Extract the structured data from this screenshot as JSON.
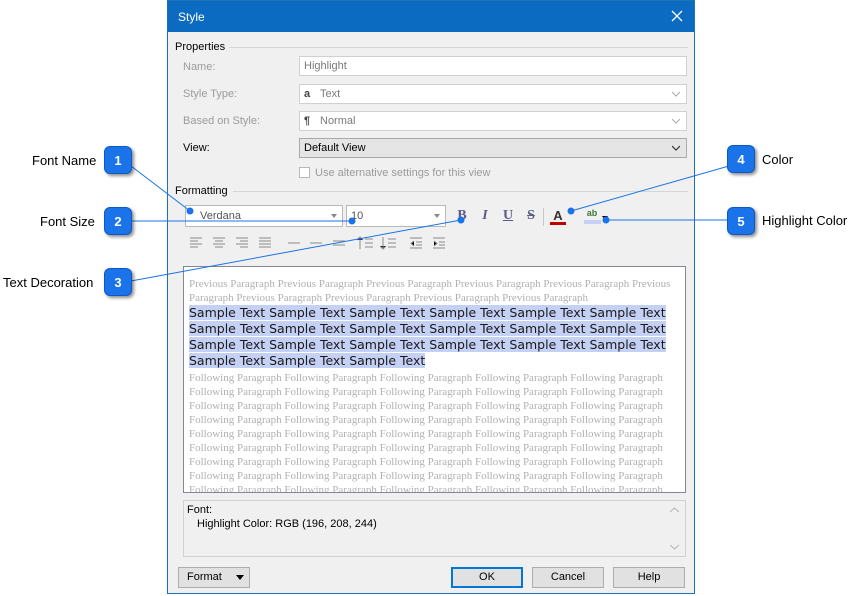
{
  "dialog": {
    "title": "Style",
    "properties_group": "Properties",
    "formatting_group": "Formatting",
    "name_label": "Name:",
    "name_value": "Highlight",
    "style_type_label": "Style Type:",
    "style_type_value": "Text",
    "style_type_icon": "a",
    "based_on_label": "Based on Style:",
    "based_on_value": "Normal",
    "based_on_icon": "¶",
    "view_label": "View:",
    "view_value": "Default View",
    "alt_settings_label": "Use alternative settings for this view",
    "alt_settings_checked": false
  },
  "toolbar": {
    "font_name": "Verdana",
    "font_size": "10",
    "bold": "B",
    "italic": "I",
    "underline": "U",
    "strike": "S",
    "font_color_glyph": "A",
    "highlight_glyph": "ab",
    "font_color": "#c00000",
    "highlight_color": "#c4d0f4"
  },
  "preview": {
    "previous": "Previous Paragraph Previous Paragraph Previous Paragraph Previous Paragraph Previous Paragraph Previous Paragraph Previous Paragraph Previous Paragraph Previous Paragraph Previous Paragraph",
    "sample": "Sample Text Sample Text Sample Text Sample Text Sample Text Sample Text Sample Text Sample Text Sample Text Sample Text Sample Text Sample Text Sample Text Sample Text Sample Text Sample Text Sample Text Sample Text Sample Text Sample Text Sample Text",
    "following": "Following Paragraph Following Paragraph Following Paragraph Following Paragraph Following Paragraph Following Paragraph Following Paragraph Following Paragraph Following Paragraph Following Paragraph Following Paragraph Following Paragraph Following Paragraph Following Paragraph Following Paragraph Following Paragraph Following Paragraph Following Paragraph Following Paragraph Following Paragraph Following Paragraph Following Paragraph Following Paragraph Following Paragraph Following Paragraph Following Paragraph Following Paragraph Following Paragraph Following Paragraph Following Paragraph Following Paragraph Following Paragraph Following Paragraph Following Paragraph Following Paragraph Following Paragraph Following Paragraph Following Paragraph Following Paragraph Following Paragraph Following Paragraph Following Paragraph Following Paragraph Following Paragraph Following Paragraph Following Paragraph Following Paragraph Following Paragraph Following Paragraph Following Paragraph"
  },
  "description": {
    "line1": "Font:",
    "line2": "Highlight Color: RGB (196, 208, 244)"
  },
  "buttons": {
    "format": "Format",
    "ok": "OK",
    "cancel": "Cancel",
    "help": "Help"
  },
  "callouts": [
    {
      "num": "1",
      "label": "Font Name"
    },
    {
      "num": "2",
      "label": "Font Size"
    },
    {
      "num": "3",
      "label": "Text Decoration"
    },
    {
      "num": "4",
      "label": "Color"
    },
    {
      "num": "5",
      "label": "Highlight Color"
    }
  ],
  "colors": {
    "titlebar": "#0b6bc1",
    "callout": "#1a73e8",
    "highlight": "#c4d0f4"
  }
}
